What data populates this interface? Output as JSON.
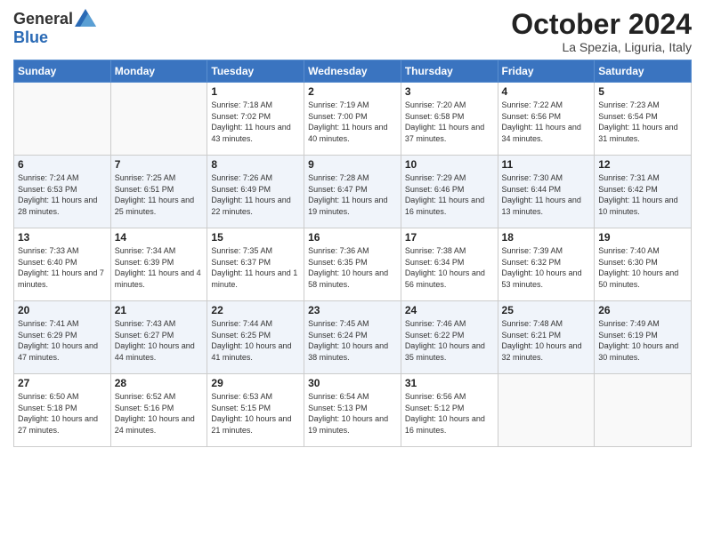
{
  "logo": {
    "general": "General",
    "blue": "Blue"
  },
  "title": "October 2024",
  "location": "La Spezia, Liguria, Italy",
  "weekdays": [
    "Sunday",
    "Monday",
    "Tuesday",
    "Wednesday",
    "Thursday",
    "Friday",
    "Saturday"
  ],
  "weeks": [
    [
      {
        "day": "",
        "detail": ""
      },
      {
        "day": "",
        "detail": ""
      },
      {
        "day": "1",
        "detail": "Sunrise: 7:18 AM\nSunset: 7:02 PM\nDaylight: 11 hours and 43 minutes."
      },
      {
        "day": "2",
        "detail": "Sunrise: 7:19 AM\nSunset: 7:00 PM\nDaylight: 11 hours and 40 minutes."
      },
      {
        "day": "3",
        "detail": "Sunrise: 7:20 AM\nSunset: 6:58 PM\nDaylight: 11 hours and 37 minutes."
      },
      {
        "day": "4",
        "detail": "Sunrise: 7:22 AM\nSunset: 6:56 PM\nDaylight: 11 hours and 34 minutes."
      },
      {
        "day": "5",
        "detail": "Sunrise: 7:23 AM\nSunset: 6:54 PM\nDaylight: 11 hours and 31 minutes."
      }
    ],
    [
      {
        "day": "6",
        "detail": "Sunrise: 7:24 AM\nSunset: 6:53 PM\nDaylight: 11 hours and 28 minutes."
      },
      {
        "day": "7",
        "detail": "Sunrise: 7:25 AM\nSunset: 6:51 PM\nDaylight: 11 hours and 25 minutes."
      },
      {
        "day": "8",
        "detail": "Sunrise: 7:26 AM\nSunset: 6:49 PM\nDaylight: 11 hours and 22 minutes."
      },
      {
        "day": "9",
        "detail": "Sunrise: 7:28 AM\nSunset: 6:47 PM\nDaylight: 11 hours and 19 minutes."
      },
      {
        "day": "10",
        "detail": "Sunrise: 7:29 AM\nSunset: 6:46 PM\nDaylight: 11 hours and 16 minutes."
      },
      {
        "day": "11",
        "detail": "Sunrise: 7:30 AM\nSunset: 6:44 PM\nDaylight: 11 hours and 13 minutes."
      },
      {
        "day": "12",
        "detail": "Sunrise: 7:31 AM\nSunset: 6:42 PM\nDaylight: 11 hours and 10 minutes."
      }
    ],
    [
      {
        "day": "13",
        "detail": "Sunrise: 7:33 AM\nSunset: 6:40 PM\nDaylight: 11 hours and 7 minutes."
      },
      {
        "day": "14",
        "detail": "Sunrise: 7:34 AM\nSunset: 6:39 PM\nDaylight: 11 hours and 4 minutes."
      },
      {
        "day": "15",
        "detail": "Sunrise: 7:35 AM\nSunset: 6:37 PM\nDaylight: 11 hours and 1 minute."
      },
      {
        "day": "16",
        "detail": "Sunrise: 7:36 AM\nSunset: 6:35 PM\nDaylight: 10 hours and 58 minutes."
      },
      {
        "day": "17",
        "detail": "Sunrise: 7:38 AM\nSunset: 6:34 PM\nDaylight: 10 hours and 56 minutes."
      },
      {
        "day": "18",
        "detail": "Sunrise: 7:39 AM\nSunset: 6:32 PM\nDaylight: 10 hours and 53 minutes."
      },
      {
        "day": "19",
        "detail": "Sunrise: 7:40 AM\nSunset: 6:30 PM\nDaylight: 10 hours and 50 minutes."
      }
    ],
    [
      {
        "day": "20",
        "detail": "Sunrise: 7:41 AM\nSunset: 6:29 PM\nDaylight: 10 hours and 47 minutes."
      },
      {
        "day": "21",
        "detail": "Sunrise: 7:43 AM\nSunset: 6:27 PM\nDaylight: 10 hours and 44 minutes."
      },
      {
        "day": "22",
        "detail": "Sunrise: 7:44 AM\nSunset: 6:25 PM\nDaylight: 10 hours and 41 minutes."
      },
      {
        "day": "23",
        "detail": "Sunrise: 7:45 AM\nSunset: 6:24 PM\nDaylight: 10 hours and 38 minutes."
      },
      {
        "day": "24",
        "detail": "Sunrise: 7:46 AM\nSunset: 6:22 PM\nDaylight: 10 hours and 35 minutes."
      },
      {
        "day": "25",
        "detail": "Sunrise: 7:48 AM\nSunset: 6:21 PM\nDaylight: 10 hours and 32 minutes."
      },
      {
        "day": "26",
        "detail": "Sunrise: 7:49 AM\nSunset: 6:19 PM\nDaylight: 10 hours and 30 minutes."
      }
    ],
    [
      {
        "day": "27",
        "detail": "Sunrise: 6:50 AM\nSunset: 5:18 PM\nDaylight: 10 hours and 27 minutes."
      },
      {
        "day": "28",
        "detail": "Sunrise: 6:52 AM\nSunset: 5:16 PM\nDaylight: 10 hours and 24 minutes."
      },
      {
        "day": "29",
        "detail": "Sunrise: 6:53 AM\nSunset: 5:15 PM\nDaylight: 10 hours and 21 minutes."
      },
      {
        "day": "30",
        "detail": "Sunrise: 6:54 AM\nSunset: 5:13 PM\nDaylight: 10 hours and 19 minutes."
      },
      {
        "day": "31",
        "detail": "Sunrise: 6:56 AM\nSunset: 5:12 PM\nDaylight: 10 hours and 16 minutes."
      },
      {
        "day": "",
        "detail": ""
      },
      {
        "day": "",
        "detail": ""
      }
    ]
  ]
}
